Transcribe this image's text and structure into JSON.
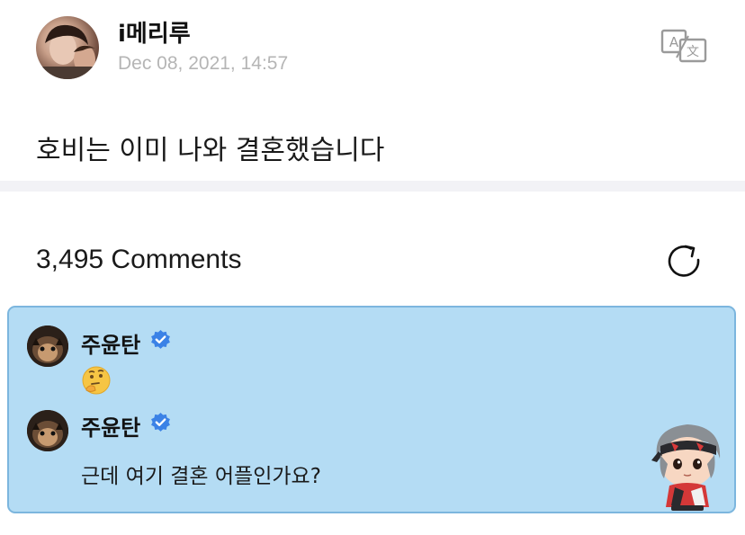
{
  "post": {
    "author": "i메리루",
    "timestamp": "Dec 08, 2021, 14:57",
    "body": "호비는 이미 나와 결혼했습니다"
  },
  "comments": {
    "count_label": "3,495 Comments"
  },
  "comment_thread": [
    {
      "name": "주윤탄",
      "verified": true,
      "content_emoji": "thinking-face"
    },
    {
      "name": "주윤탄",
      "verified": true,
      "content": "근데 여기 결혼 어플인가요?"
    }
  ],
  "icons": {
    "translate": "translate-icon",
    "refresh": "refresh-icon",
    "verified": "verified-badge-icon"
  },
  "colors": {
    "highlight_bg": "#b4dcf4",
    "highlight_border": "#7cb6de",
    "verified": "#3b82e6",
    "timestamp": "#b5b5b5"
  }
}
